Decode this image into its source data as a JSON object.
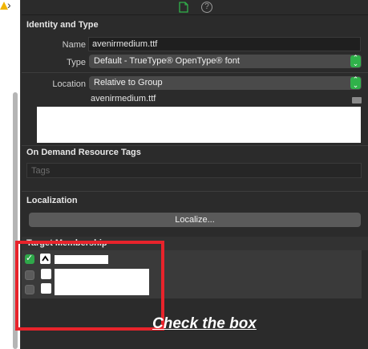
{
  "inspector": {
    "identity": {
      "title": "Identity and Type",
      "name_label": "Name",
      "name_value": "avenirmedium.ttf",
      "type_label": "Type",
      "type_value": "Default - TrueType® OpenType® font",
      "location_label": "Location",
      "location_value": "Relative to Group",
      "full_path_name": "avenirmedium.ttf"
    },
    "on_demand": {
      "title": "On Demand Resource Tags",
      "tags_placeholder": "Tags"
    },
    "localization": {
      "title": "Localization",
      "localize_button": "Localize..."
    },
    "target_membership": {
      "title": "Target Membership",
      "targets": [
        {
          "checked": true
        },
        {
          "checked": false
        },
        {
          "checked": false
        }
      ]
    }
  },
  "annotation": {
    "text": "Check the box",
    "highlight_color": "#e8232b"
  },
  "colors": {
    "checkbox_checked": "#2fa84a",
    "popup_stepper": "#30b24a"
  },
  "icons": [
    "warning-icon",
    "chevron-right-icon",
    "file-inspector-icon",
    "help-icon",
    "folder-icon",
    "target-app-icon"
  ]
}
